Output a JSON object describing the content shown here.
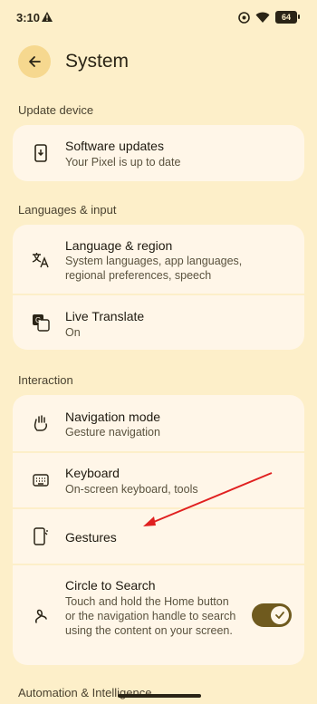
{
  "status_bar": {
    "time": "3:10",
    "battery": "64"
  },
  "header": {
    "title": "System"
  },
  "sections": {
    "update": "Update device",
    "languages": "Languages & input",
    "interaction": "Interaction",
    "automation": "Automation & Intelligence"
  },
  "items": {
    "software_updates": {
      "label": "Software updates",
      "sub": "Your Pixel is up to date"
    },
    "language_region": {
      "label": "Language & region",
      "sub": "System languages, app languages, regional preferences, speech"
    },
    "live_translate": {
      "label": "Live Translate",
      "sub": "On"
    },
    "navigation_mode": {
      "label": "Navigation mode",
      "sub": "Gesture navigation"
    },
    "keyboard": {
      "label": "Keyboard",
      "sub": "On-screen keyboard, tools"
    },
    "gestures": {
      "label": "Gestures"
    },
    "circle_to_search": {
      "label": "Circle to Search",
      "sub": "Touch and hold the Home button or the navigation handle to search using the content on your screen.",
      "enabled": true
    }
  },
  "colors": {
    "background": "#FDEFC9",
    "card": "#FFF6E8",
    "accent": "#6F5A1E",
    "annotation": "#E02020"
  }
}
